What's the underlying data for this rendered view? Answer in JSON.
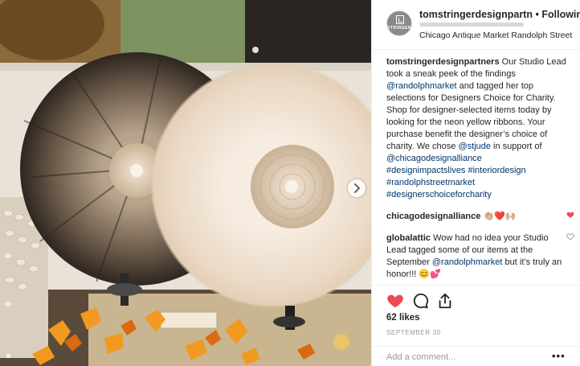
{
  "post": {
    "username": "tomstringerdesignpartn",
    "separator": "•",
    "follow_label": "Following",
    "location": "Chicago Antique Market Randolph Street",
    "avatar_brand": "STRINGER"
  },
  "caption": {
    "author": "tomstringerdesignpartners",
    "part1": " Our Studio Lead took a sneak peek of the findings ",
    "mention1": "@randolphmarket",
    "part2": " and tagged her top selections for Designers Choice for Charity. Shop for designer-selected items today by looking for the neon yellow ribbons. Your purchase benefit the designer’s choice of charity. We chose ",
    "mention2": "@stjude",
    "part3": " in support of ",
    "mention3": "@chicagodesignalliance",
    "tag1": "#designimpactslives",
    "tag2": "#interiordesign",
    "tag3": "#randolphstreetmarket",
    "tag4": "#designerschoiceforcharity"
  },
  "comments": [
    {
      "author": "chicagodesignalliance",
      "text": "👏🏼❤️🙌🏼",
      "liked": true
    },
    {
      "author": "globalattic",
      "text_a": " Wow had no idea your Studio Lead tagged some of our items at the September ",
      "mention": "@randolphmarket",
      "text_b": " but it’s truly an honor!!! 😊💕",
      "liked": false
    }
  ],
  "actions": {
    "likes": "62 likes",
    "date": "SEPTEMBER 30",
    "icons": [
      "heart-filled-icon",
      "comment-icon",
      "share-icon"
    ]
  },
  "add_comment": {
    "placeholder": "Add a comment...",
    "more_label": "•••"
  },
  "colors": {
    "like_red": "#ed4956",
    "link_blue": "#003569",
    "meta_gray": "#999999"
  }
}
